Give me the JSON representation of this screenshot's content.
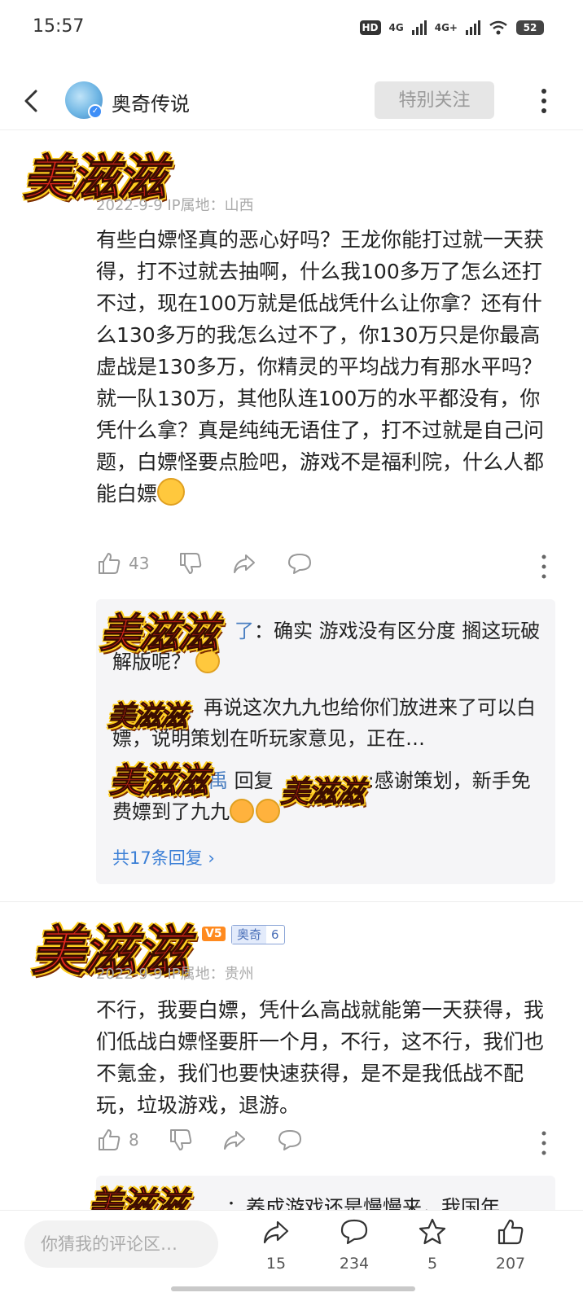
{
  "status_bar": {
    "time": "15:57",
    "hd": "HD",
    "net1": "4G",
    "net2": "4G+",
    "battery": "52"
  },
  "header": {
    "title": "奥奇传说",
    "follow_label": "特别关注"
  },
  "sticker_text": "美滋滋",
  "comment1": {
    "meta": "2022-9-9 IP属地：山西",
    "text": "有些白嫖怪真的恶心好吗？王龙你能打过就一天获得，打不过就去抽啊，什么我100多万了怎么还打不过，现在100万就是低战凭什么让你拿？还有什么130多万的我怎么过不了，你130万只是你最高虚战是130多万，你精灵的平均战力有那水平吗？就一队130万，其他队连100万的水平都没有，你凭什么拿？真是纯纯无语住了，打不过就是自己问题，白嫖怪要点脸吧，游戏不是福利院，什么人都能白嫖",
    "likes": "43",
    "replies": [
      {
        "name_tail": "了",
        "text": "：确实 游戏没有区分度 搁这玩破解版呢？"
      },
      {
        "name_tail": "：",
        "text": "再说这次九九也给你们放进来了可以白嫖，说明策划在听玩家意见，正在…"
      },
      {
        "name_tail": "禹",
        "mid": "回复",
        "text": ":感谢策划，新手免费嫖到了九九"
      }
    ],
    "reply_count": "共17条回复 ›"
  },
  "comment2": {
    "badge_lv": "V5",
    "group_name": "奥奇",
    "group_level": "6",
    "meta": "2022-9-9 IP属地：贵州",
    "text": "不行，我要白嫖，凭什么高战就能第一天获得，我们低战白嫖怪要肝一个月，不行，这不行，我们也不氪金，我们也要快速获得，是不是我低战不配玩，垃圾游戏，退游。",
    "likes": "8",
    "reply_preview": "：养成游戏还是慢慢来，我国年"
  },
  "bottom_bar": {
    "input_placeholder": "你猜我的评论区…",
    "share_count": "15",
    "comment_count": "234",
    "star_count": "5",
    "like_count": "207"
  }
}
